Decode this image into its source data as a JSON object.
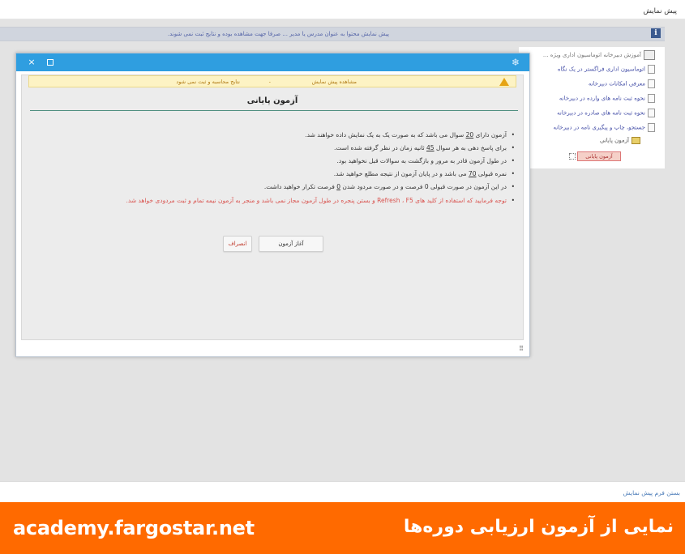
{
  "window": {
    "title": "پیش نمایش"
  },
  "notice": {
    "text": "پیش نمایش محتوا به عنوان مدرس یا مدیر ... صرفا جهت مشاهده بوده و نتایج ثبت نمی شوند."
  },
  "tree": {
    "root_label": "آموزش دبیرخانه اتوماسیون اداری ویژه ...",
    "items": [
      "اتوماسیون اداری فراگستر در یک نگاه",
      "معرفی امکانات دبیرخانه",
      "نحوه ثبت نامه های وارده در دبیرخانه",
      "نحوه ثبت نامه های صادره در دبیرخانه",
      "جستجو، چاپ و پیگیری نامه در دبیرخانه"
    ],
    "folder_label": "آزمون پایانی",
    "selected_label": "آزمون پایانی"
  },
  "dialog": {
    "warning": {
      "mode_label": "مشاهده پیش نمایش",
      "separator": "-",
      "result_label": "نتایج محاسبه و ثبت نمی شود"
    },
    "title": "آزمون پایانی",
    "rules": [
      {
        "before": "آزمون دارای ",
        "value": "20",
        "after": " سوال می باشد که به صورت یک به یک نمایش داده خواهند شد."
      },
      {
        "before": "برای پاسخ دهی به هر سوال ",
        "value": "45",
        "after": " ثانیه زمان در نظر گرفته شده است."
      },
      {
        "text": "در طول آزمون قادر به مرور و بازگشت به سوالات قبل نخواهید بود."
      },
      {
        "before": "نمره قبولی ",
        "value": "70",
        "after": " می باشد و در پایان آزمون از نتیجه مطلع خواهید شد."
      },
      {
        "before": "در این آزمون در صورت قبولی 0 فرصت و در صورت مردود شدن ",
        "value": "0",
        "after": " فرصت تکرار خواهید داشت."
      }
    ],
    "warning_rule": "توجه فرمایید که استفاده از کلید های Refresh ، F5 و بستن پنجره در طول آزمون مجاز نمی باشد و منجر به آزمون نیمه تمام و ثبت مردودی خواهد شد.",
    "start_button": "آغاز آزمون",
    "cancel_button": "انصراف",
    "close_glyph": "×"
  },
  "footer": {
    "close_form_link": "بستن فرم پیش نمایش"
  },
  "banner": {
    "title": "نمایی از آزمون ارزیابی دوره‌ها",
    "url": "academy.fargostar.net"
  },
  "colors": {
    "header_blue": "#2f9ee0",
    "banner_orange": "#ff6a00",
    "warning_red": "#d9534f"
  },
  "icons": [
    "close-icon",
    "maximize-icon",
    "logo-icon",
    "warning-icon",
    "info-icon",
    "document-icon",
    "folder-icon",
    "resize-grip-icon"
  ]
}
